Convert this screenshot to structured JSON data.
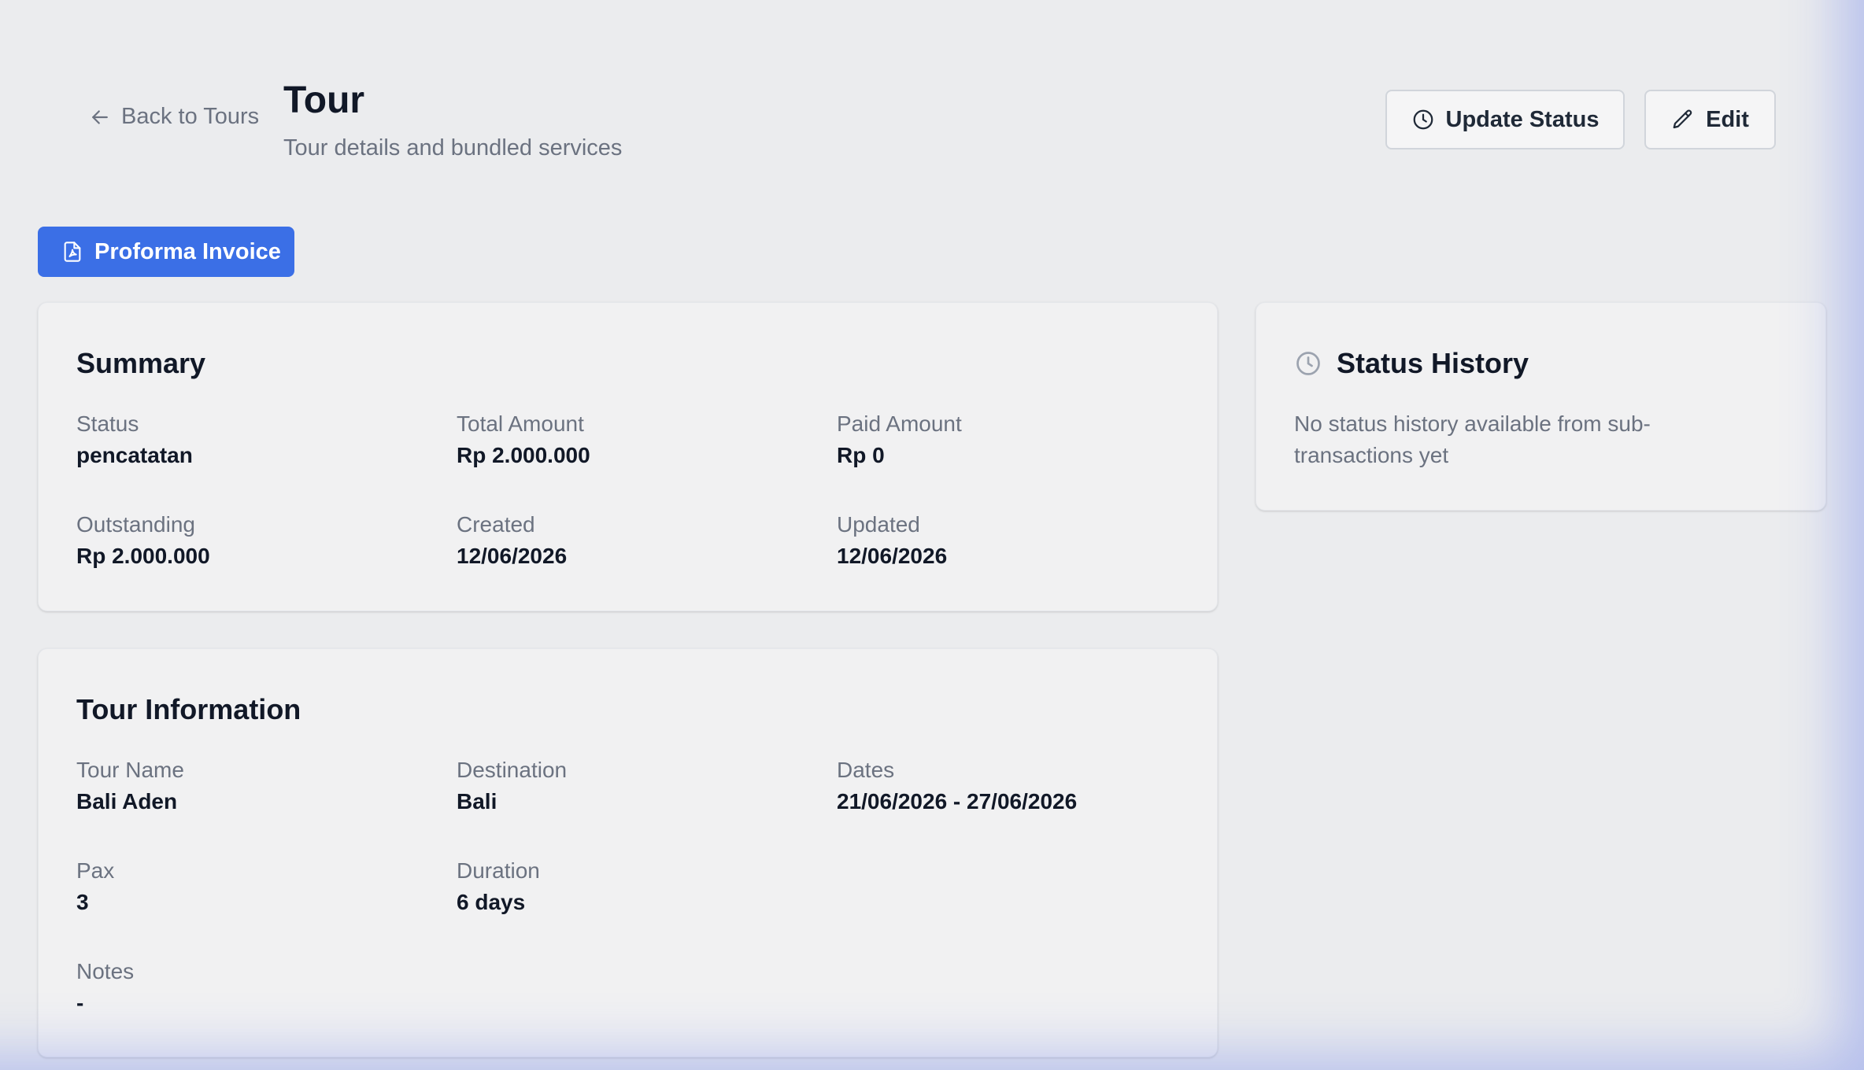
{
  "header": {
    "back_label": "Back to Tours",
    "title": "Tour",
    "subtitle": "Tour details and bundled services",
    "update_status_label": "Update Status",
    "edit_label": "Edit"
  },
  "actions": {
    "proforma_label": "Proforma Invoice"
  },
  "summary": {
    "title": "Summary",
    "fields": [
      {
        "label": "Status",
        "value": "pencatatan"
      },
      {
        "label": "Total Amount",
        "value": "Rp 2.000.000"
      },
      {
        "label": "Paid Amount",
        "value": "Rp 0"
      },
      {
        "label": "Outstanding",
        "value": "Rp 2.000.000"
      },
      {
        "label": "Created",
        "value": "12/06/2026"
      },
      {
        "label": "Updated",
        "value": "12/06/2026"
      }
    ]
  },
  "status_history": {
    "title": "Status History",
    "empty_text": "No status history available from sub-transactions yet"
  },
  "tour_info": {
    "title": "Tour Information",
    "fields": [
      {
        "label": "Tour Name",
        "value": "Bali Aden"
      },
      {
        "label": "Destination",
        "value": "Bali"
      },
      {
        "label": "Dates",
        "value": "21/06/2026 - 27/06/2026"
      },
      {
        "label": "Pax",
        "value": "3"
      },
      {
        "label": "Duration",
        "value": "6 days"
      },
      {
        "label": "Notes",
        "value": "-"
      }
    ]
  },
  "icons": {
    "back": "arrow-left-icon",
    "update_status": "clock-icon",
    "edit": "pencil-icon",
    "proforma": "pdf-file-icon",
    "history": "clock-icon"
  },
  "colors": {
    "primary": "#3b6fe6",
    "background": "#ebecee",
    "card": "#f1f1f2",
    "muted_text": "#6b7280",
    "text": "#111827"
  }
}
